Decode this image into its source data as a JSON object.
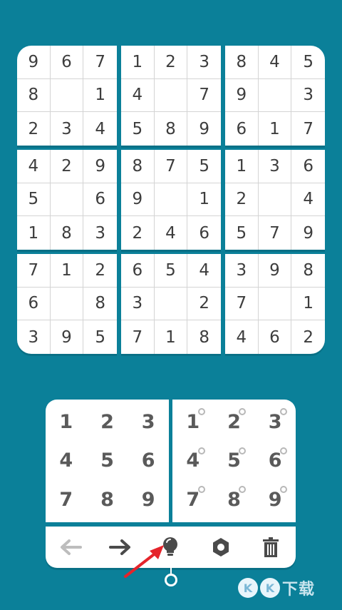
{
  "board": {
    "boxes": [
      [
        "9",
        "6",
        "7",
        "8",
        "",
        "1",
        "2",
        "3",
        "4"
      ],
      [
        "1",
        "2",
        "3",
        "4",
        "",
        "7",
        "5",
        "8",
        "9"
      ],
      [
        "8",
        "4",
        "5",
        "9",
        "",
        "3",
        "6",
        "1",
        "7"
      ],
      [
        "4",
        "2",
        "9",
        "5",
        "",
        "6",
        "1",
        "8",
        "3"
      ],
      [
        "8",
        "7",
        "5",
        "9",
        "",
        "1",
        "2",
        "4",
        "6"
      ],
      [
        "1",
        "3",
        "6",
        "2",
        "",
        "4",
        "5",
        "7",
        "9"
      ],
      [
        "7",
        "1",
        "2",
        "6",
        "",
        "8",
        "3",
        "9",
        "5"
      ],
      [
        "6",
        "5",
        "4",
        "3",
        "",
        "2",
        "7",
        "1",
        "8"
      ],
      [
        "3",
        "9",
        "8",
        "7",
        "",
        "1",
        "4",
        "6",
        "2"
      ]
    ]
  },
  "pad": {
    "numbers": [
      "1",
      "2",
      "3",
      "4",
      "5",
      "6",
      "7",
      "8",
      "9"
    ],
    "notes": [
      "1",
      "2",
      "3",
      "4",
      "5",
      "6",
      "7",
      "8",
      "9"
    ]
  },
  "toolbar": {
    "icons": [
      "arrow-left-icon",
      "arrow-right-icon",
      "lightbulb-icon",
      "gear-icon",
      "trash-icon"
    ],
    "undo_color": "#bdbdbd",
    "icon_color": "#4a4a4a"
  },
  "theme": {
    "background": "#0b8099",
    "panel": "#ffffff",
    "annotation": "#e5242b"
  },
  "watermark": {
    "badge_1": "K",
    "badge_2": "K",
    "text": "下载"
  }
}
